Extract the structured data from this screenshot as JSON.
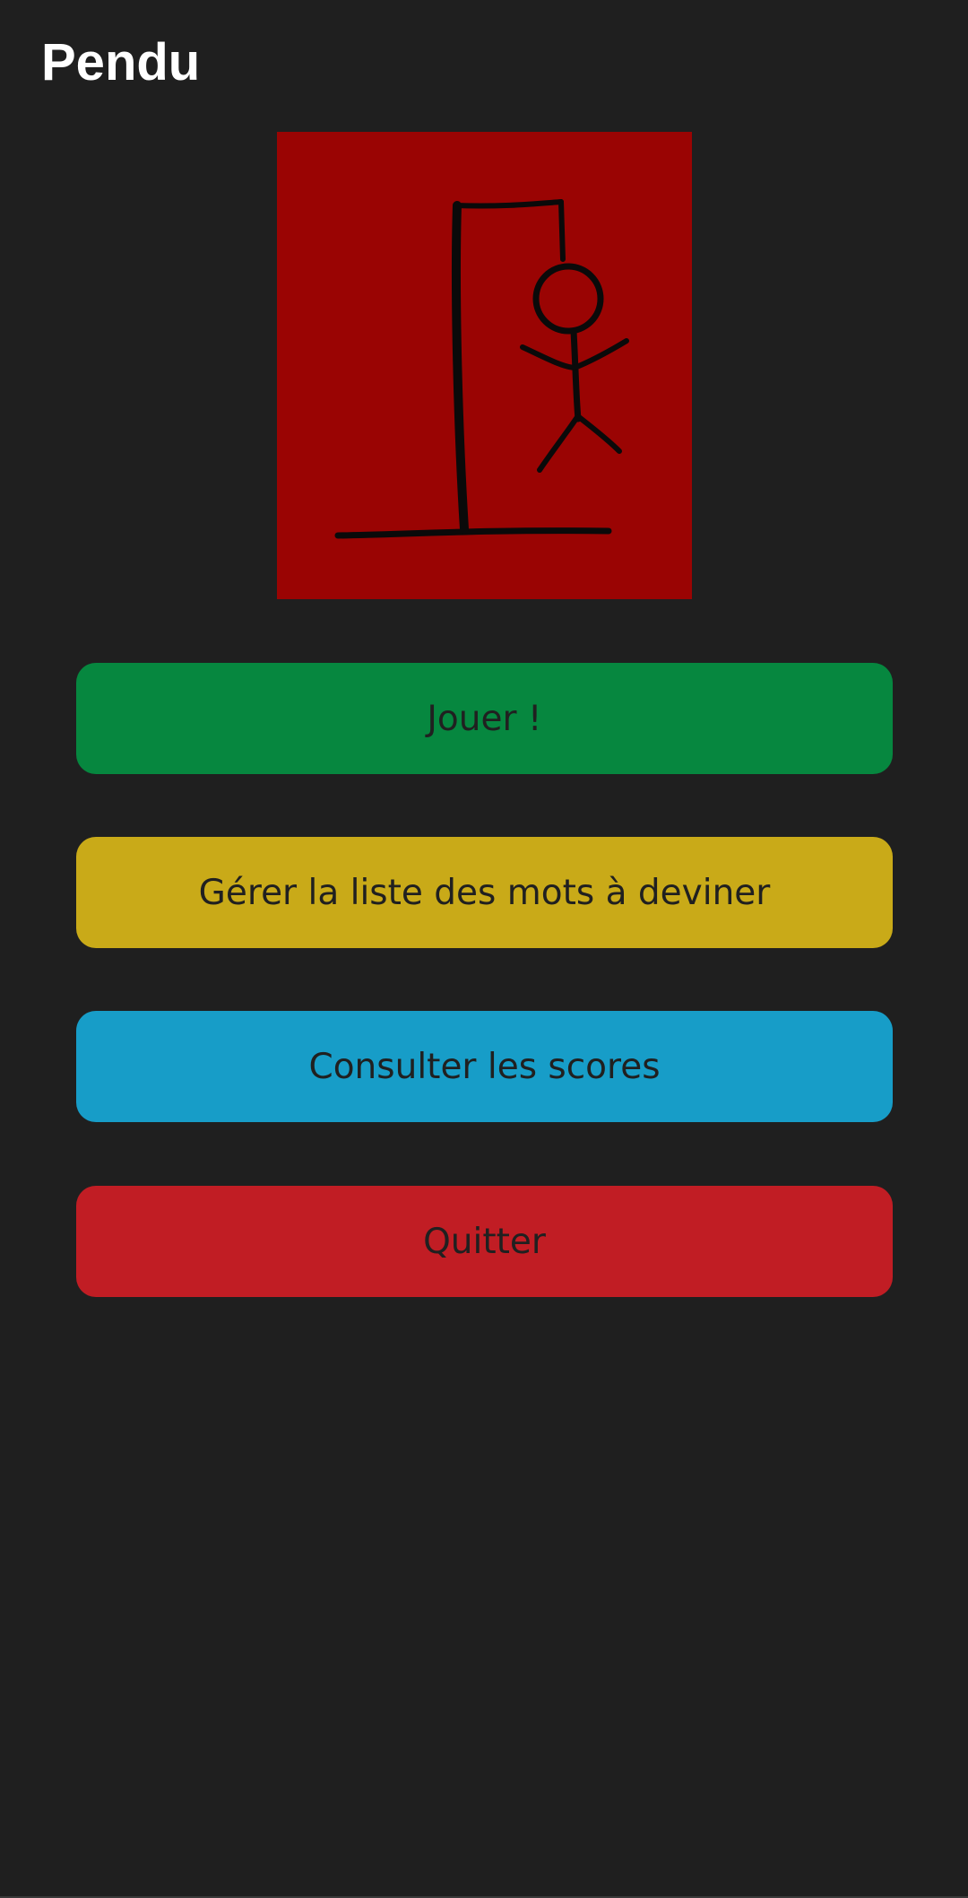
{
  "app": {
    "title": "Pendu"
  },
  "logo": {
    "icon": "hangman-icon",
    "background_color": "#9a0403"
  },
  "menu": {
    "buttons": [
      {
        "label": "Jouer !",
        "color": "#06873f"
      },
      {
        "label": "Gérer la liste des mots à deviner",
        "color": "#c9aa18"
      },
      {
        "label": "Consulter les scores",
        "color": "#179dc8"
      },
      {
        "label": "Quitter",
        "color": "#c11d24"
      }
    ]
  },
  "colors": {
    "background": "#1f1f1f",
    "title_text": "#ffffff",
    "button_text": "#202020"
  }
}
